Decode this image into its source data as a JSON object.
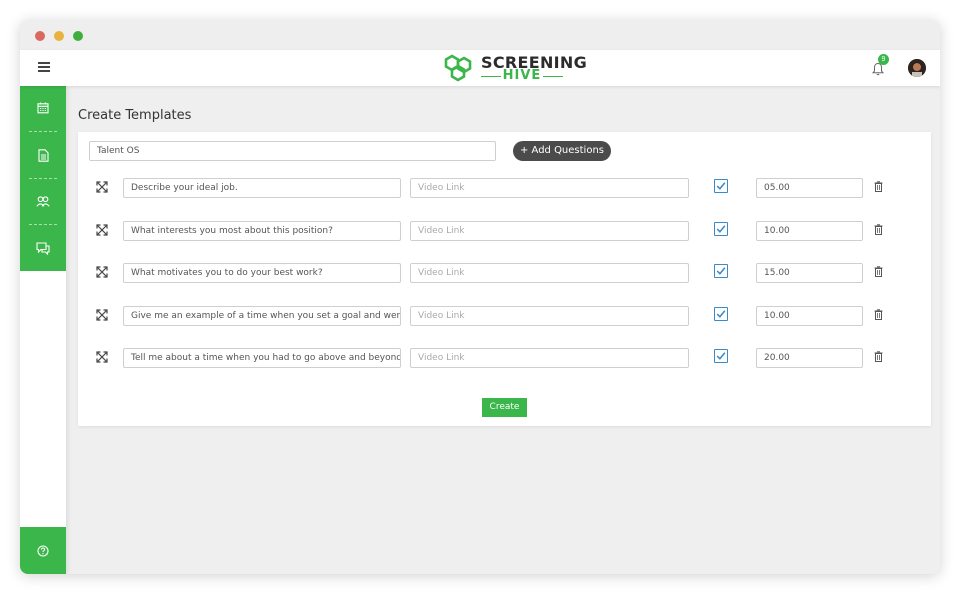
{
  "brand": {
    "name_line1": "SCREENING",
    "name_line2": "HIVE",
    "green": "#3ab64a"
  },
  "header": {
    "notification_count": "9",
    "icons": [
      "menu-icon",
      "bell-icon",
      "avatar"
    ]
  },
  "sidebar": {
    "items": [
      {
        "name": "calendar-icon"
      },
      {
        "name": "document-icon"
      },
      {
        "name": "users-icon"
      },
      {
        "name": "chat-icon"
      }
    ],
    "help": "help-icon"
  },
  "page": {
    "title": "Create Templates"
  },
  "form": {
    "template_name": "Talent OS",
    "add_questions_label": "+ Add Questions",
    "video_placeholder": "Video Link",
    "create_label": "Create",
    "questions": [
      {
        "text": "Describe your ideal job.",
        "checked": true,
        "time": "05.00"
      },
      {
        "text": "What interests you most about this position?",
        "checked": true,
        "time": "10.00"
      },
      {
        "text": "What motivates you to do your best work?",
        "checked": true,
        "time": "15.00"
      },
      {
        "text": "Give me an example of a time when you set a goal and were able",
        "checked": true,
        "time": "10.00"
      },
      {
        "text": "Tell me about a time when you had to go above and beyond the",
        "checked": true,
        "time": "20.00"
      }
    ]
  }
}
